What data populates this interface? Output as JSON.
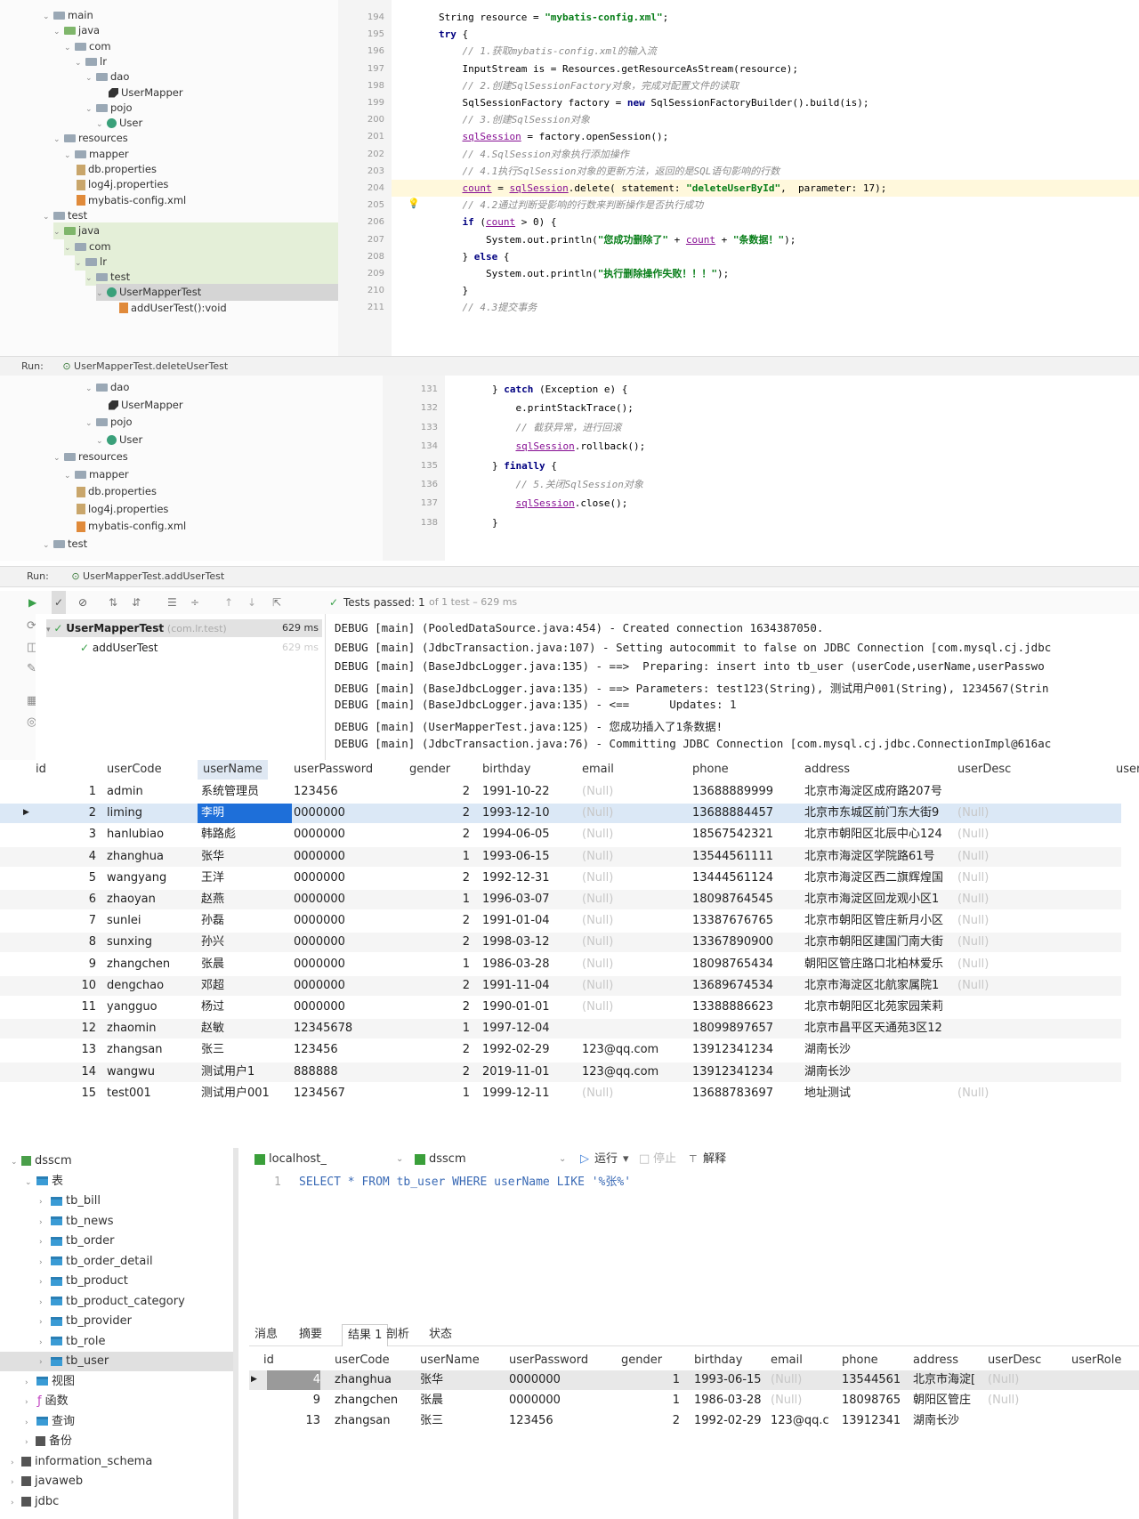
{
  "ide": {
    "tree_top": [
      {
        "label": "main",
        "depth": 4,
        "type": "folder"
      },
      {
        "label": "java",
        "depth": 5,
        "type": "folder-src"
      },
      {
        "label": "com",
        "depth": 6,
        "type": "folder"
      },
      {
        "label": "lr",
        "depth": 7,
        "type": "folder"
      },
      {
        "label": "dao",
        "depth": 8,
        "type": "folder"
      },
      {
        "label": "UserMapper",
        "depth": 10,
        "type": "interface"
      },
      {
        "label": "pojo",
        "depth": 8,
        "type": "folder"
      },
      {
        "label": "User",
        "depth": 9,
        "type": "class"
      },
      {
        "label": "resources",
        "depth": 5,
        "type": "folder"
      },
      {
        "label": "mapper",
        "depth": 6,
        "type": "folder"
      },
      {
        "label": "db.properties",
        "depth": 7,
        "type": "file"
      },
      {
        "label": "log4j.properties",
        "depth": 7,
        "type": "file"
      },
      {
        "label": "mybatis-config.xml",
        "depth": 7,
        "type": "xml"
      },
      {
        "label": "test",
        "depth": 4,
        "type": "folder"
      },
      {
        "label": "java",
        "depth": 5,
        "type": "folder-test"
      },
      {
        "label": "com",
        "depth": 6,
        "type": "folder"
      },
      {
        "label": "lr",
        "depth": 7,
        "type": "folder"
      },
      {
        "label": "test",
        "depth": 8,
        "type": "folder"
      },
      {
        "label": "UserMapperTest",
        "depth": 9,
        "type": "class"
      },
      {
        "label": "addUserTest():void",
        "depth": 11,
        "type": "method"
      }
    ],
    "code_top": [
      {
        "n": "194",
        "t": "        String resource = \"mybatis-config.xml\";"
      },
      {
        "n": "195",
        "t": "        try {"
      },
      {
        "n": "196",
        "t": "            // 1.获取mybatis-config.xml的输入流"
      },
      {
        "n": "197",
        "t": "            InputStream is = Resources.getResourceAsStream(resource);"
      },
      {
        "n": "198",
        "t": "            // 2.创建SqlSessionFactory对象，完成对配置文件的读取"
      },
      {
        "n": "199",
        "t": "            SqlSessionFactory factory = new SqlSessionFactoryBuilder().build(is);"
      },
      {
        "n": "200",
        "t": "            // 3.创建SqlSession对象"
      },
      {
        "n": "201",
        "t": "            sqlSession = factory.openSession();"
      },
      {
        "n": "202",
        "t": "            // 4.SqlSession对象执行添加操作"
      },
      {
        "n": "203",
        "t": "            // 4.1执行SqlSession对象的更新方法，返回的是SQL语句影响的行数"
      },
      {
        "n": "204",
        "t": "            count = sqlSession.delete( statement: \"deleteUserById\",  parameter: 17);"
      },
      {
        "n": "205",
        "t": "            // 4.2通过判断受影响的行数来判断操作是否执行成功"
      },
      {
        "n": "206",
        "t": "            if (count > 0) {"
      },
      {
        "n": "207",
        "t": "                System.out.println(\"您成功删除了\" + count + \"条数据！\");"
      },
      {
        "n": "208",
        "t": "            } else {"
      },
      {
        "n": "209",
        "t": "                System.out.println(\"执行删除操作失败！！！\");"
      },
      {
        "n": "210",
        "t": "            }"
      },
      {
        "n": "211",
        "t": "            // 4.3提交事务"
      }
    ],
    "run_tab_1": "UserMapperTest.deleteUserTest",
    "tree_mid": [
      {
        "label": "dao",
        "depth": 8,
        "type": "folder"
      },
      {
        "label": "UserMapper",
        "depth": 10,
        "type": "interface"
      },
      {
        "label": "pojo",
        "depth": 8,
        "type": "folder"
      },
      {
        "label": "User",
        "depth": 9,
        "type": "class"
      },
      {
        "label": "resources",
        "depth": 5,
        "type": "folder"
      },
      {
        "label": "mapper",
        "depth": 6,
        "type": "folder"
      },
      {
        "label": "db.properties",
        "depth": 7,
        "type": "file"
      },
      {
        "label": "log4j.properties",
        "depth": 7,
        "type": "file"
      },
      {
        "label": "mybatis-config.xml",
        "depth": 7,
        "type": "xml"
      },
      {
        "label": "test",
        "depth": 4,
        "type": "folder"
      }
    ],
    "code_mid": [
      {
        "n": "131",
        "t": "        } catch (Exception e) {"
      },
      {
        "n": "132",
        "t": "            e.printStackTrace();"
      },
      {
        "n": "133",
        "t": "            // 截获异常，进行回滚"
      },
      {
        "n": "134",
        "t": "            sqlSession.rollback();"
      },
      {
        "n": "135",
        "t": "        } finally {"
      },
      {
        "n": "136",
        "t": "            // 5.关闭SqlSession对象"
      },
      {
        "n": "137",
        "t": "            sqlSession.close();"
      },
      {
        "n": "138",
        "t": "        }"
      }
    ],
    "run_label": "Run:",
    "run_tab_2": "UserMapperTest.addUserTest",
    "tests_passed": "Tests passed: 1",
    "tests_detail": "of 1 test – 629 ms",
    "test_tree": [
      {
        "label": "UserMapperTest",
        "sub": "(com.lr.test)",
        "time": "629 ms"
      },
      {
        "label": "addUserTest",
        "sub": "",
        "time": "629 ms"
      }
    ],
    "console": [
      "DEBUG [main] (PooledDataSource.java:454) - Created connection 1634387050.",
      "DEBUG [main] (JdbcTransaction.java:107) - Setting autocommit to false on JDBC Connection [com.mysql.cj.jdbc",
      "DEBUG [main] (BaseJdbcLogger.java:135) - ==>  Preparing: insert into tb_user (userCode,userName,userPasswo",
      "DEBUG [main] (BaseJdbcLogger.java:135) - ==> Parameters: test123(String), 测试用户001(String), 1234567(Strin",
      "DEBUG [main] (BaseJdbcLogger.java:135) - <==      Updates: 1",
      "DEBUG [main] (UserMapperTest.java:125) - 您成功插入了1条数据!",
      "DEBUG [main] (JdbcTransaction.java:76) - Committing JDBC Connection [com.mysql.cj.jdbc.ConnectionImpl@616ac"
    ]
  },
  "grid": {
    "columns": [
      "id",
      "userCode",
      "userName",
      "userPassword",
      "gender",
      "birthday",
      "email",
      "phone",
      "address",
      "userDesc",
      "user"
    ],
    "rows": [
      [
        "1",
        "admin",
        "系统管理员",
        "123456",
        "2",
        "1991-10-22",
        "(Null)",
        "13688889999",
        "北京市海淀区成府路207号",
        ""
      ],
      [
        "2",
        "liming",
        "李明",
        "0000000",
        "2",
        "1993-12-10",
        "(Null)",
        "13688884457",
        "北京市东城区前门东大街9",
        "(Null)"
      ],
      [
        "3",
        "hanlubiao",
        "韩路彪",
        "0000000",
        "2",
        "1994-06-05",
        "(Null)",
        "18567542321",
        "北京市朝阳区北辰中心124",
        "(Null)"
      ],
      [
        "4",
        "zhanghua",
        "张华",
        "0000000",
        "1",
        "1993-06-15",
        "(Null)",
        "13544561111",
        "北京市海淀区学院路61号",
        "(Null)"
      ],
      [
        "5",
        "wangyang",
        "王洋",
        "0000000",
        "2",
        "1992-12-31",
        "(Null)",
        "13444561124",
        "北京市海淀区西二旗辉煌国",
        "(Null)"
      ],
      [
        "6",
        "zhaoyan",
        "赵燕",
        "0000000",
        "1",
        "1996-03-07",
        "(Null)",
        "18098764545",
        "北京市海淀区回龙观小区1",
        "(Null)"
      ],
      [
        "7",
        "sunlei",
        "孙磊",
        "0000000",
        "2",
        "1991-01-04",
        "(Null)",
        "13387676765",
        "北京市朝阳区管庄新月小区",
        "(Null)"
      ],
      [
        "8",
        "sunxing",
        "孙兴",
        "0000000",
        "2",
        "1998-03-12",
        "(Null)",
        "13367890900",
        "北京市朝阳区建国门南大街",
        "(Null)"
      ],
      [
        "9",
        "zhangchen",
        "张晨",
        "0000000",
        "1",
        "1986-03-28",
        "(Null)",
        "18098765434",
        "朝阳区管庄路口北柏林爱乐",
        "(Null)"
      ],
      [
        "10",
        "dengchao",
        "邓超",
        "0000000",
        "2",
        "1991-11-04",
        "(Null)",
        "13689674534",
        "北京市海淀区北航家属院1",
        "(Null)"
      ],
      [
        "11",
        "yangguo",
        "杨过",
        "0000000",
        "2",
        "1990-01-01",
        "(Null)",
        "13388886623",
        "北京市朝阳区北苑家园茉莉",
        ""
      ],
      [
        "12",
        "zhaomin",
        "赵敏",
        "12345678",
        "1",
        "1997-12-04",
        "",
        "18099897657",
        "北京市昌平区天通苑3区12",
        ""
      ],
      [
        "13",
        "zhangsan",
        "张三",
        "123456",
        "2",
        "1992-02-29",
        "123@qq.com",
        "13912341234",
        "湖南长沙",
        ""
      ],
      [
        "14",
        "wangwu",
        "测试用户1",
        "888888",
        "2",
        "2019-11-01",
        "123@qq.com",
        "13912341234",
        "湖南长沙",
        ""
      ],
      [
        "15",
        "test001",
        "测试用户001",
        "1234567",
        "1",
        "1999-12-11",
        "(Null)",
        "13688783697",
        "地址测试",
        "(Null)"
      ]
    ]
  },
  "navicat": {
    "tree": [
      {
        "label": "dsscm",
        "depth": 0,
        "icon": "db"
      },
      {
        "label": "表",
        "depth": 1,
        "icon": "tbl"
      },
      {
        "label": "tb_bill",
        "depth": 2,
        "icon": "tbl"
      },
      {
        "label": "tb_news",
        "depth": 2,
        "icon": "tbl"
      },
      {
        "label": "tb_order",
        "depth": 2,
        "icon": "tbl"
      },
      {
        "label": "tb_order_detail",
        "depth": 2,
        "icon": "tbl"
      },
      {
        "label": "tb_product",
        "depth": 2,
        "icon": "tbl"
      },
      {
        "label": "tb_product_category",
        "depth": 2,
        "icon": "tbl"
      },
      {
        "label": "tb_provider",
        "depth": 2,
        "icon": "tbl"
      },
      {
        "label": "tb_role",
        "depth": 2,
        "icon": "tbl"
      },
      {
        "label": "tb_user",
        "depth": 2,
        "icon": "tbl"
      },
      {
        "label": "视图",
        "depth": 1,
        "icon": "tbl"
      },
      {
        "label": "函数",
        "depth": 1,
        "icon": "fn"
      },
      {
        "label": "查询",
        "depth": 1,
        "icon": "tbl"
      },
      {
        "label": "备份",
        "depth": 1,
        "icon": "bk"
      },
      {
        "label": "information_schema",
        "depth": 0,
        "icon": "dbgray"
      },
      {
        "label": "javaweb",
        "depth": 0,
        "icon": "dbgray"
      },
      {
        "label": "jdbc",
        "depth": 0,
        "icon": "dbgray"
      }
    ],
    "connection": "localhost_",
    "database": "dsscm",
    "run_label": "运行",
    "stop_label": "停止",
    "explain_label": "解释",
    "sql_line": "1",
    "sql": "SELECT * FROM tb_user WHERE userName LIKE '%张%'",
    "tabs": [
      "消息",
      "摘要",
      "结果 1",
      "剖析",
      "状态"
    ],
    "columns": [
      "id",
      "userCode",
      "userName",
      "userPassword",
      "gender",
      "birthday",
      "email",
      "phone",
      "address",
      "userDesc",
      "userRole"
    ],
    "rows": [
      [
        "4",
        "zhanghua",
        "张华",
        "0000000",
        "1",
        "1993-06-15",
        "(Null)",
        "13544561",
        "北京市海淀[",
        "(Null)",
        ""
      ],
      [
        "9",
        "zhangchen",
        "张晨",
        "0000000",
        "1",
        "1986-03-28",
        "(Null)",
        "18098765",
        "朝阳区管庄",
        "(Null)",
        ""
      ],
      [
        "13",
        "zhangsan",
        "张三",
        "123456",
        "2",
        "1992-02-29",
        "123@qq.c",
        "13912341",
        "湖南长沙",
        "",
        ""
      ]
    ]
  }
}
